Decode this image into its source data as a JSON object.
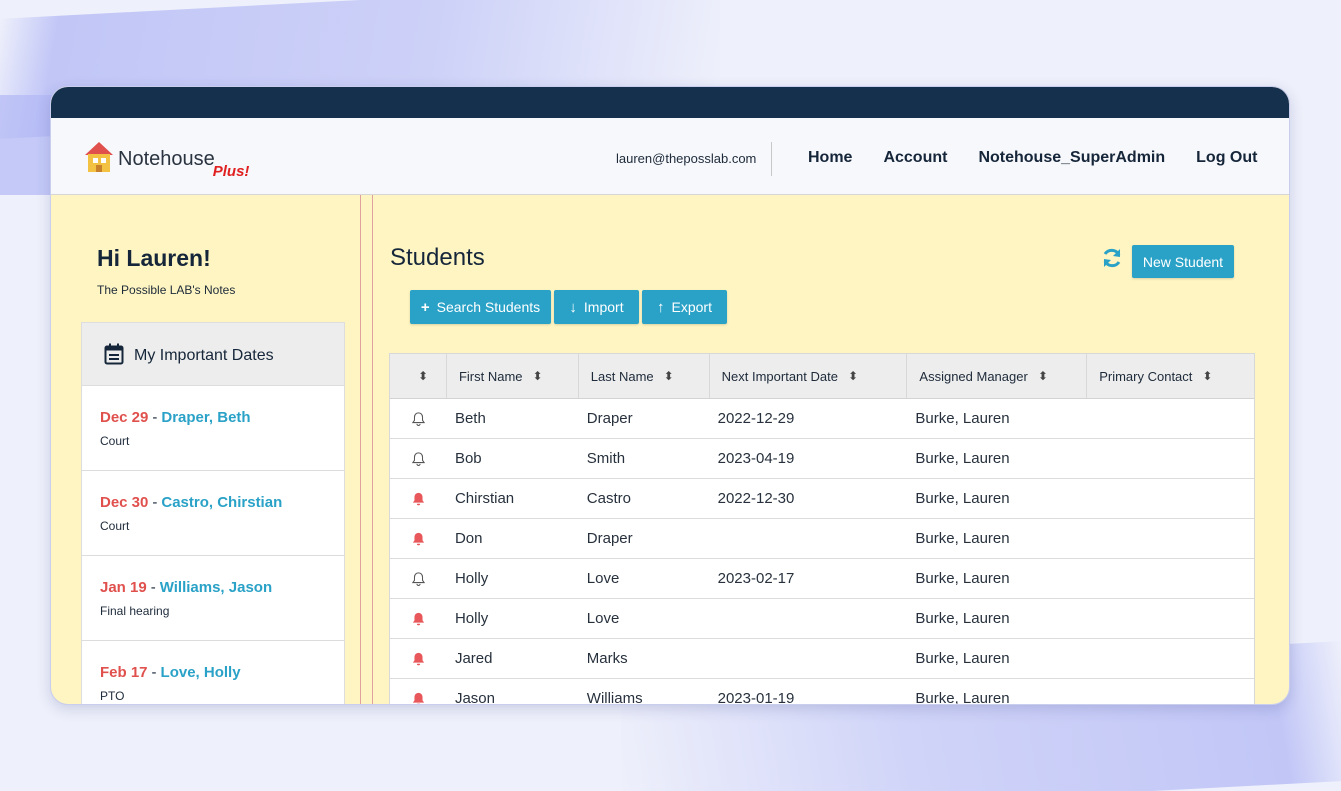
{
  "brand": {
    "name": "Notehouse",
    "suffix": "Plus!"
  },
  "nav": {
    "email": "lauren@theposslab.com",
    "links": [
      "Home",
      "Account",
      "Notehouse_SuperAdmin",
      "Log Out"
    ]
  },
  "sidebar": {
    "greeting": "Hi Lauren!",
    "subtitle": "The Possible LAB's Notes",
    "dates_title": "My Important Dates",
    "dates": [
      {
        "date": "Dec 29",
        "name": "Draper, Beth",
        "note": "Court"
      },
      {
        "date": "Dec 30",
        "name": "Castro, Chirstian",
        "note": "Court"
      },
      {
        "date": "Jan 19",
        "name": "Williams, Jason",
        "note": "Final hearing"
      },
      {
        "date": "Feb 17",
        "name": "Love, Holly",
        "note": "PTO"
      }
    ]
  },
  "main": {
    "title": "Students",
    "new_button": "New Student",
    "search_button": "Search Students",
    "import_button": "Import",
    "export_button": "Export"
  },
  "table": {
    "headers": [
      "First Name",
      "Last Name",
      "Next Important Date",
      "Assigned Manager",
      "Primary Contact"
    ],
    "rows": [
      {
        "alert": "outline",
        "first": "Beth",
        "last": "Draper",
        "date": "2022-12-29",
        "manager": "Burke, Lauren",
        "contact": ""
      },
      {
        "alert": "outline",
        "first": "Bob",
        "last": "Smith",
        "date": "2023-04-19",
        "manager": "Burke, Lauren",
        "contact": ""
      },
      {
        "alert": "filled",
        "first": "Chirstian",
        "last": "Castro",
        "date": "2022-12-30",
        "manager": "Burke, Lauren",
        "contact": ""
      },
      {
        "alert": "filled",
        "first": "Don",
        "last": "Draper",
        "date": "",
        "manager": "Burke, Lauren",
        "contact": ""
      },
      {
        "alert": "outline",
        "first": "Holly",
        "last": "Love",
        "date": "2023-02-17",
        "manager": "Burke, Lauren",
        "contact": ""
      },
      {
        "alert": "filled",
        "first": "Holly",
        "last": "Love",
        "date": "",
        "manager": "Burke, Lauren",
        "contact": ""
      },
      {
        "alert": "filled",
        "first": "Jared",
        "last": "Marks",
        "date": "",
        "manager": "Burke, Lauren",
        "contact": ""
      },
      {
        "alert": "filled",
        "first": "Jason",
        "last": "Williams",
        "date": "2023-01-19",
        "manager": "Burke, Lauren",
        "contact": ""
      }
    ]
  },
  "colors": {
    "accent": "#2aa2c7",
    "date_red": "#e0504d",
    "navy": "#15304d",
    "page_bg": "#fef5c2",
    "bell_filled": "#e8575a"
  }
}
